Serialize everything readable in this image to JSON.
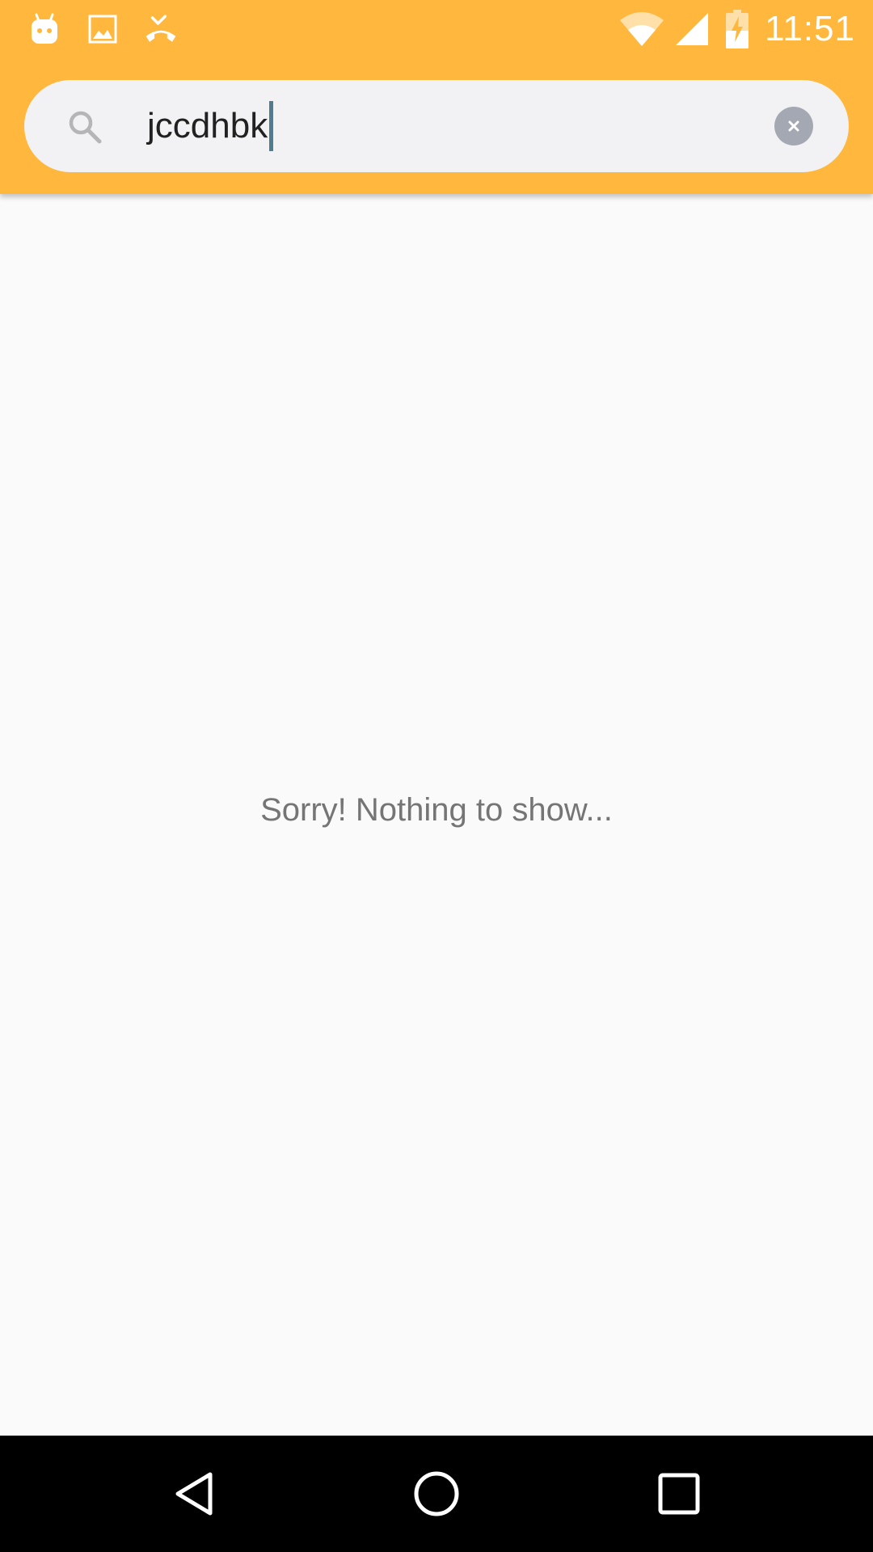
{
  "status_bar": {
    "time": "11:51",
    "left_icons": [
      "android-debug-icon",
      "image-icon",
      "missed-call-icon"
    ],
    "right_icons": [
      "wifi-icon",
      "cell-signal-icon",
      "battery-charging-icon"
    ]
  },
  "search": {
    "value": "jccdhbk",
    "icon": "search-icon",
    "clear_icon": "clear-icon"
  },
  "main": {
    "empty_message": "Sorry! Nothing to show..."
  },
  "nav": {
    "icons": [
      "back-icon",
      "home-icon",
      "recents-icon"
    ]
  },
  "colors": {
    "app_bar": "#FFB83D",
    "search_background": "#F2F2F4",
    "cursor": "#4E7D8F",
    "body_background": "#FAFAFA",
    "message_text": "#757575"
  }
}
